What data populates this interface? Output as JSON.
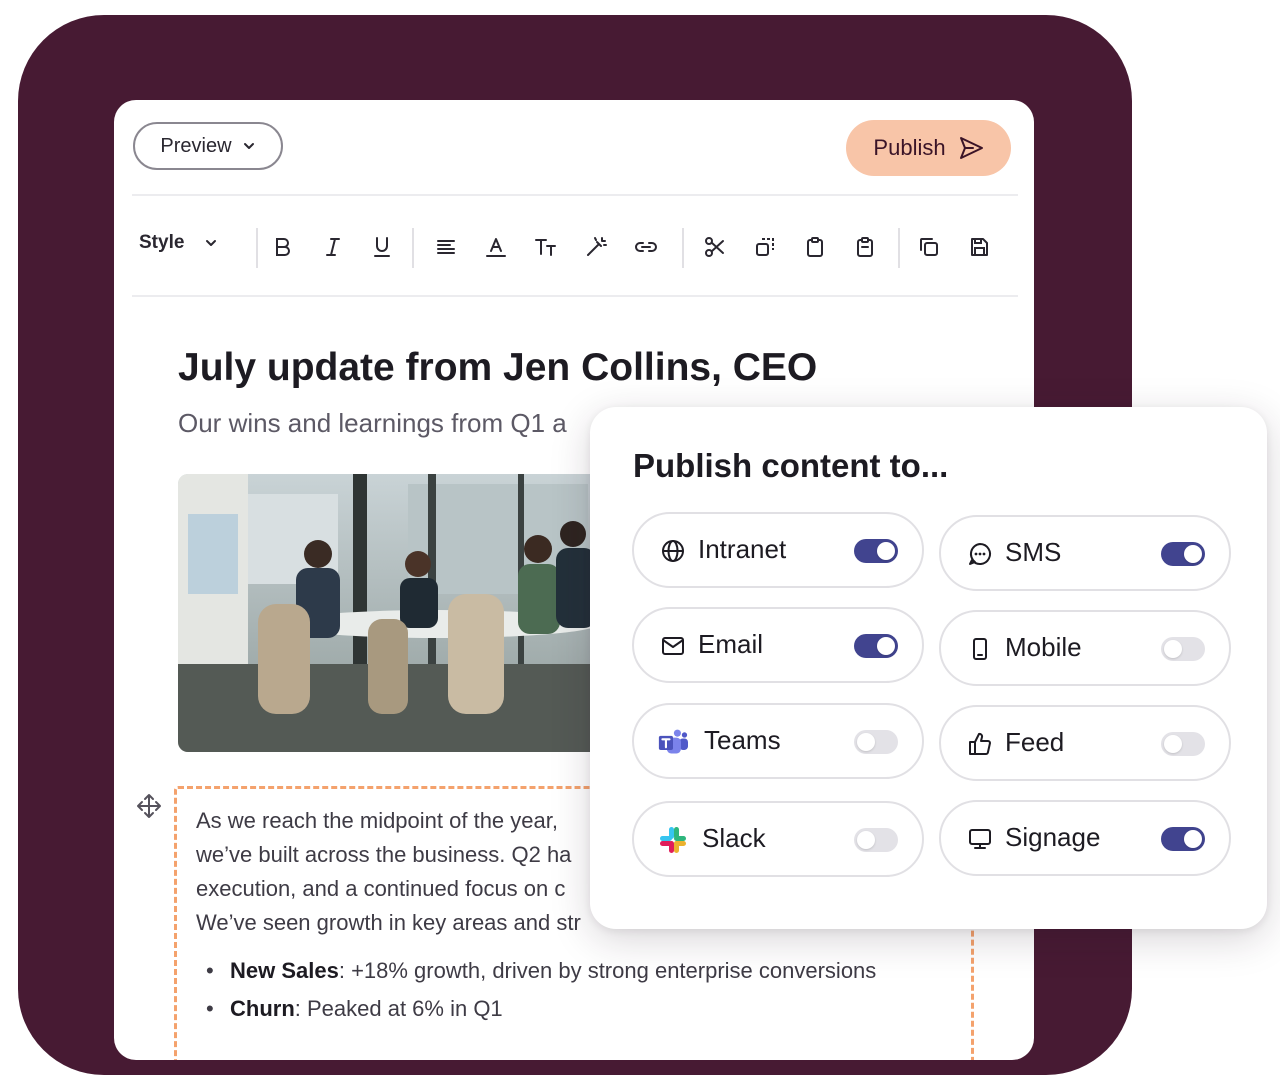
{
  "editor": {
    "preview_label": "Preview",
    "publish_label": "Publish",
    "toolbar": {
      "style_label": "Style",
      "tools": [
        "bold",
        "italic",
        "underline",
        "align-left",
        "text-color",
        "text-size",
        "magic",
        "link",
        "cut",
        "copy-region",
        "paste",
        "clipboard",
        "duplicate",
        "save"
      ]
    },
    "title": "July update from Jen Collins, CEO",
    "subtitle": "Our wins and learnings from Q1 a",
    "paragraph": [
      "As we reach the midpoint of the year,",
      "we’ve built across the business. Q2 ha",
      "execution, and a continued focus on c",
      "We’ve seen growth in key areas and str"
    ],
    "bullets": [
      {
        "label": "New Sales",
        "text": ": +18% growth, driven by strong enterprise conversions"
      },
      {
        "label": "Churn",
        "text": ": Peaked at 6% in Q1"
      }
    ]
  },
  "publish_panel": {
    "title": "Publish content to...",
    "channels": [
      {
        "label": "Intranet",
        "icon": "globe-icon",
        "enabled": true
      },
      {
        "label": "SMS",
        "icon": "chat-bubble-icon",
        "enabled": true
      },
      {
        "label": "Email",
        "icon": "mail-icon",
        "enabled": true
      },
      {
        "label": "Mobile",
        "icon": "phone-icon",
        "enabled": false
      },
      {
        "label": "Teams",
        "icon": "teams-logo-icon",
        "enabled": false
      },
      {
        "label": "Feed",
        "icon": "thumbs-up-icon",
        "enabled": false
      },
      {
        "label": "Slack",
        "icon": "slack-logo-icon",
        "enabled": false
      },
      {
        "label": "Signage",
        "icon": "monitor-icon",
        "enabled": true
      }
    ]
  },
  "colors": {
    "backdrop": "#471a33",
    "publish_button": "#f8c5a8",
    "toggle_on": "#41448f",
    "toggle_off": "#e3e2e7",
    "block_border": "#f4a26d"
  }
}
